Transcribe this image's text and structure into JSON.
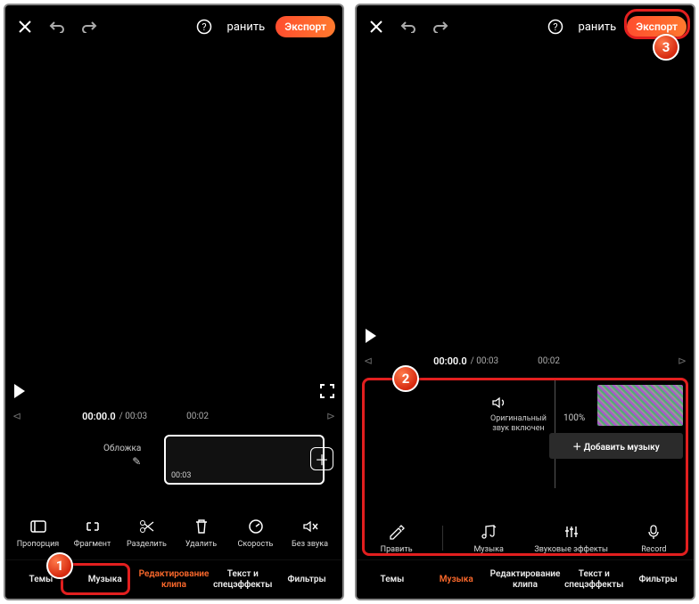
{
  "shared": {
    "save_label": "ранить",
    "export_label": "Экспорт",
    "time_current": "00:00.0",
    "time_total": "/ 00:03",
    "time_tick": "00:02"
  },
  "left": {
    "cover_label": "Обложка",
    "clip_duration": "00:03",
    "tools": [
      {
        "name": "aspect",
        "label": "Пропорция"
      },
      {
        "name": "fragment",
        "label": "Фрагмент"
      },
      {
        "name": "split",
        "label": "Разделить"
      },
      {
        "name": "delete",
        "label": "Удалить"
      },
      {
        "name": "speed",
        "label": "Скорость"
      },
      {
        "name": "mute",
        "label": "Без звука"
      }
    ],
    "tabs": [
      {
        "name": "themes",
        "label": "Темы",
        "active": false
      },
      {
        "name": "music",
        "label": "Музыка",
        "active": false
      },
      {
        "name": "edit",
        "label": "Редактирование клипа",
        "active": true
      },
      {
        "name": "textfx",
        "label": "Текст и спецэффекты",
        "active": false
      },
      {
        "name": "filters",
        "label": "Фильтры",
        "active": false
      }
    ]
  },
  "right": {
    "orig_sound_line1": "Оригинальный",
    "orig_sound_line2": "звук включен",
    "percent": "100%",
    "add_music_label": "Добавить музыку",
    "tools": [
      {
        "name": "edit",
        "label": "Править"
      },
      {
        "name": "music",
        "label": "Музыка"
      },
      {
        "name": "soundfx",
        "label": "Звуковые эффекты"
      },
      {
        "name": "record",
        "label": "Record"
      }
    ],
    "tabs": [
      {
        "name": "themes",
        "label": "Темы",
        "active": false
      },
      {
        "name": "music",
        "label": "Музыка",
        "active": true
      },
      {
        "name": "edit",
        "label": "Редактирование клипа",
        "active": false
      },
      {
        "name": "textfx",
        "label": "Текст и спецэффекты",
        "active": false
      },
      {
        "name": "filters",
        "label": "Фильтры",
        "active": false
      }
    ]
  },
  "callouts": {
    "1": "1",
    "2": "2",
    "3": "3"
  }
}
